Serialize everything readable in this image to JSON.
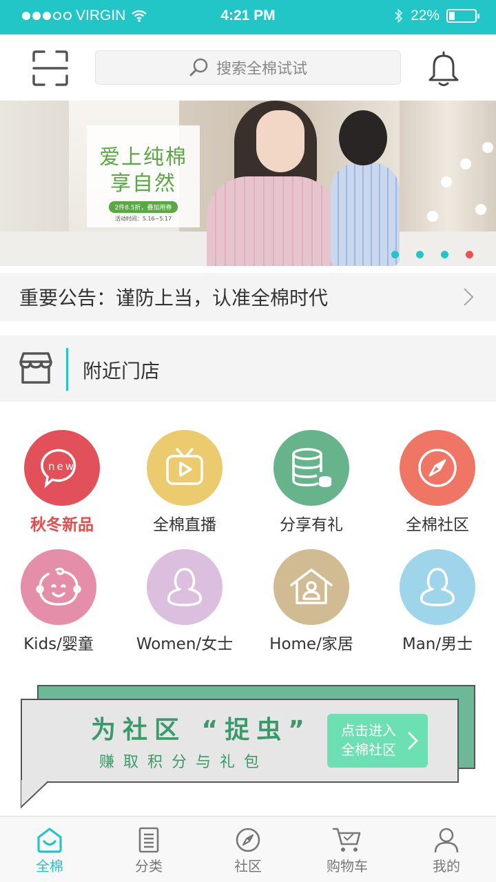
{
  "status_bar": {
    "carrier": "VIRGIN",
    "time": "4:21 PM",
    "battery": "22%",
    "battery_level": 0.22
  },
  "header": {
    "search_placeholder": "搜索全棉试试",
    "icons": [
      "scan-icon",
      "search-icon",
      "bell-icon"
    ]
  },
  "banner": {
    "title_line1": "爱上纯棉",
    "title_line2": "享自然",
    "promo_tag": "2件8.5折，叠加用券",
    "promo_date": "活动时间：5.16~5.17",
    "page_count": 4,
    "active_index": 3,
    "dot_color": "#22c6c7",
    "active_dot_color": "#ee4f4f"
  },
  "notice": {
    "text": "重要公告：谨防上当，认准全棉时代"
  },
  "stores": {
    "label": "附近门店"
  },
  "categories": [
    {
      "label": "秋冬新品",
      "icon": "new-icon",
      "color": "#e2505a",
      "highlight": true
    },
    {
      "label": "全棉直播",
      "icon": "tv-icon",
      "color": "#eccb6e"
    },
    {
      "label": "分享有礼",
      "icon": "database-icon",
      "color": "#67b48c"
    },
    {
      "label": "全棉社区",
      "icon": "compass-icon",
      "color": "#ef7564"
    },
    {
      "label": "Kids/婴童",
      "icon": "baby-icon",
      "color": "#e58ea9"
    },
    {
      "label": "Women/女士",
      "icon": "user-icon",
      "color": "#dcbfdf"
    },
    {
      "label": "Home/家居",
      "icon": "house-icon",
      "color": "#d0bb92"
    },
    {
      "label": "Man/男士",
      "icon": "user-icon",
      "color": "#9ed5ea"
    }
  ],
  "promo": {
    "title": "为社区 “捉虫”",
    "subtitle": "赚取积分与礼包",
    "button_line1": "点击进入",
    "button_line2": "全棉社区"
  },
  "tabbar": {
    "items": [
      {
        "label": "全棉",
        "icon": "home-icon",
        "active": true
      },
      {
        "label": "分类",
        "icon": "list-icon"
      },
      {
        "label": "社区",
        "icon": "compass-icon"
      },
      {
        "label": "购物车",
        "icon": "cart-icon"
      },
      {
        "label": "我的",
        "icon": "user-icon"
      }
    ],
    "active_color": "#22c6c7"
  }
}
